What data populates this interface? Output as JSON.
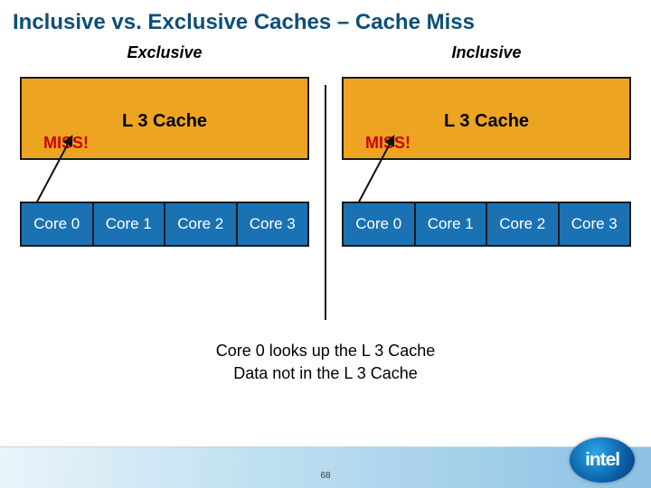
{
  "title": "Inclusive vs. Exclusive Caches – Cache Miss",
  "left": {
    "label": "Exclusive",
    "l3_title": "L 3 Cache",
    "l3_status": "MISS!",
    "cores": [
      "Core 0",
      "Core 1",
      "Core 2",
      "Core 3"
    ]
  },
  "right": {
    "label": "Inclusive",
    "l3_title": "L 3 Cache",
    "l3_status": "MISS!",
    "cores": [
      "Core 0",
      "Core 1",
      "Core 2",
      "Core 3"
    ]
  },
  "caption_line1": "Core 0 looks up the L 3 Cache",
  "caption_line2": "Data not in the L 3 Cache",
  "page_number": "68",
  "logo": "intel",
  "colors": {
    "title": "#0b4f7a",
    "l3_fill": "#eda421",
    "core_fill": "#1a72b3",
    "miss": "#c00"
  }
}
